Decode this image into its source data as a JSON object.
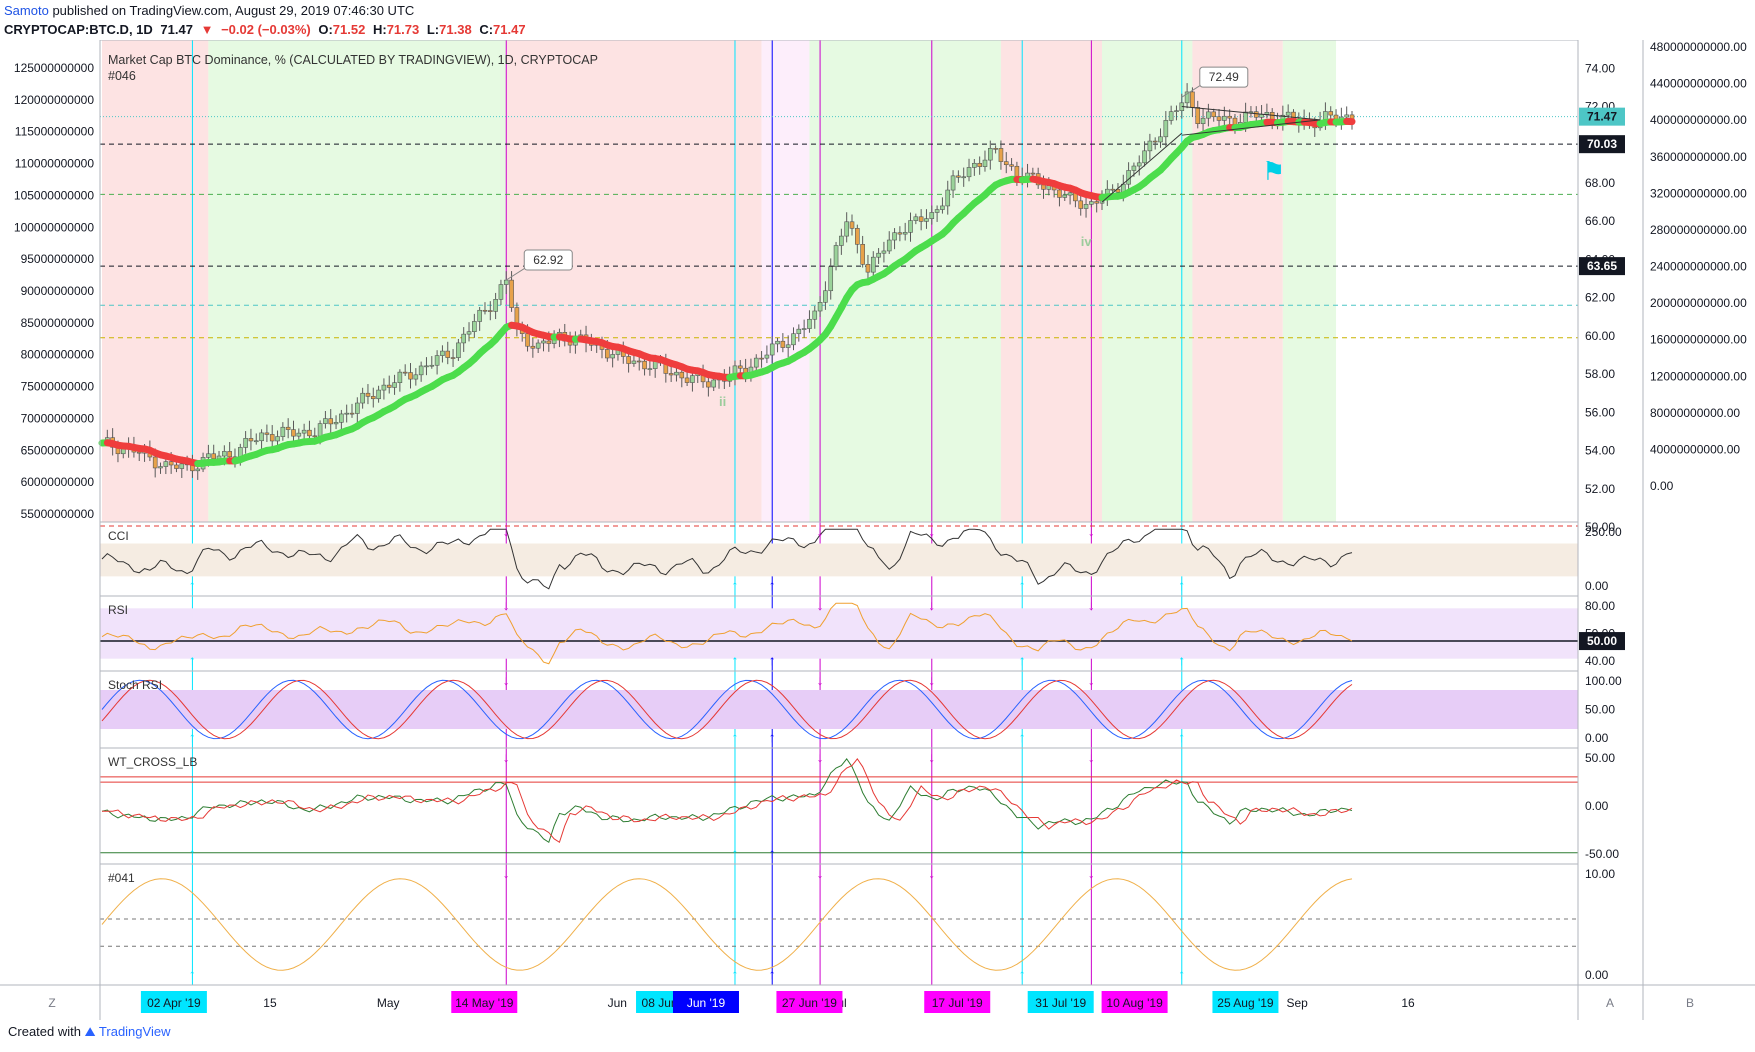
{
  "header": {
    "publisher": "Samoto",
    "published_text": "published on TradingView.com, August 29, 2019 07:46:30 UTC",
    "symbol": "CRYPTOCAP:BTC.D, 1D",
    "last": "71.47",
    "change": "−0.02 (−0.03%)",
    "o_label": "O:",
    "o_val": "71.52",
    "h_label": "H:",
    "h_val": "71.73",
    "l_label": "L:",
    "l_val": "71.38",
    "c_label": "C:",
    "c_val": "71.47"
  },
  "footer": {
    "created_with": "Created with",
    "brand": "TradingView"
  },
  "chart_data": {
    "type": "candlestick",
    "title": "Market Cap BTC Dominance, % (CALCULATED BY TRADINGVIEW), 1D, CRYPTOCAP",
    "subtitle": "#046",
    "dates_range": [
      "2019-03-23",
      "2019-08-29"
    ],
    "closes_anchor": [
      [
        0,
        54.4
      ],
      [
        6,
        54.0
      ],
      [
        12,
        53.2
      ],
      [
        16,
        53.1
      ],
      [
        20,
        53.6
      ],
      [
        24,
        53.8
      ],
      [
        30,
        54.8
      ],
      [
        40,
        55.0
      ],
      [
        46,
        56.0
      ],
      [
        52,
        57.2
      ],
      [
        60,
        58.3
      ],
      [
        66,
        59.2
      ],
      [
        70,
        60.7
      ],
      [
        74,
        62.0
      ],
      [
        76,
        62.9
      ],
      [
        78,
        60.2
      ],
      [
        82,
        59.4
      ],
      [
        86,
        60.0
      ],
      [
        92,
        59.6
      ],
      [
        98,
        58.8
      ],
      [
        104,
        58.4
      ],
      [
        110,
        57.8
      ],
      [
        114,
        57.6
      ],
      [
        118,
        57.9
      ],
      [
        122,
        58.5
      ],
      [
        126,
        59.3
      ],
      [
        130,
        60.0
      ],
      [
        134,
        61.0
      ],
      [
        138,
        64.5
      ],
      [
        140,
        66.0
      ],
      [
        144,
        63.5
      ],
      [
        150,
        65.6
      ],
      [
        156,
        66.3
      ],
      [
        160,
        68.0
      ],
      [
        164,
        69.0
      ],
      [
        168,
        69.6
      ],
      [
        172,
        68.5
      ],
      [
        178,
        67.8
      ],
      [
        182,
        67.1
      ],
      [
        186,
        66.9
      ],
      [
        190,
        67.5
      ],
      [
        196,
        69.5
      ],
      [
        200,
        71.2
      ],
      [
        204,
        72.5
      ],
      [
        206,
        71.5
      ],
      [
        212,
        71.3
      ],
      [
        218,
        71.6
      ],
      [
        224,
        71.3
      ],
      [
        228,
        71.2
      ],
      [
        232,
        71.5
      ],
      [
        235,
        71.47
      ]
    ],
    "price_axis": {
      "ticks": [
        "74.00",
        "72.00",
        "70.00",
        "68.00",
        "66.00",
        "64.00",
        "62.00",
        "60.00",
        "58.00",
        "56.00",
        "54.00",
        "52.00",
        "50.00"
      ],
      "min": 50,
      "max": 74.8
    },
    "left_axis": {
      "ticks": [
        "125000000000",
        "120000000000",
        "115000000000",
        "110000000000",
        "105000000000",
        "100000000000",
        "95000000000",
        "90000000000",
        "85000000000",
        "80000000000",
        "75000000000",
        "70000000000",
        "65000000000",
        "60000000000",
        "55000000000"
      ]
    },
    "right_axis": {
      "ticks": [
        "480000000000.00",
        "440000000000.00",
        "400000000000.00",
        "360000000000.00",
        "320000000000.00",
        "280000000000.00",
        "240000000000.00",
        "200000000000.00",
        "160000000000.00",
        "120000000000.00",
        "80000000000.00",
        "40000000000.00",
        "0.00"
      ]
    },
    "price_labels": [
      {
        "text": "71.47",
        "value": 71.47,
        "color": "#4dc6c6"
      },
      {
        "text": "70.03",
        "value": 70.03,
        "color": "#131722"
      },
      {
        "text": "63.65",
        "value": 63.65,
        "color": "#131722"
      }
    ],
    "callouts": [
      {
        "text": "62.92",
        "value": 62.92,
        "day": 76
      },
      {
        "text": "72.49",
        "value": 72.49,
        "day": 203
      }
    ],
    "wave_labels": [
      {
        "text": "ii",
        "day": 116
      },
      {
        "text": "iv",
        "day": 184
      }
    ],
    "time_axis": {
      "ticks": [
        {
          "label": "15",
          "day": 23
        },
        {
          "label": "May",
          "day": 39
        },
        {
          "label": "Jun",
          "day": 70
        },
        {
          "label": "Jul",
          "day": 100
        },
        {
          "label": "Sep",
          "day": 162
        },
        {
          "label": "16",
          "day": 177
        }
      ]
    },
    "date_markers": [
      {
        "label": "02 Apr '19",
        "day": 10,
        "color": "#00e5ff",
        "text_color": "#131722"
      },
      {
        "label": "14 May '19",
        "day": 52,
        "color": "#ff00ff",
        "text_color": "#131722"
      },
      {
        "label": "08 Jun '19",
        "day": 77,
        "color": "#00e5ff",
        "text_color": "#131722"
      },
      {
        "label": "Jun '19",
        "day": 82,
        "color": "#0000ff",
        "text_color": "#ffffff"
      },
      {
        "label": "27 Jun '19",
        "day": 96,
        "color": "#ff00ff",
        "text_color": "#131722"
      },
      {
        "label": "17 Jul '19",
        "day": 116,
        "color": "#ff00ff",
        "text_color": "#131722"
      },
      {
        "label": "31 Jul '19",
        "day": 130,
        "color": "#00e5ff",
        "text_color": "#131722"
      },
      {
        "label": "10 Aug '19",
        "day": 140,
        "color": "#ff00ff",
        "text_color": "#131722"
      },
      {
        "label": "25 Aug '19",
        "day": 155,
        "color": "#00e5ff",
        "text_color": "#131722"
      }
    ],
    "panels": [
      {
        "name": "CCI",
        "ticks": [
          "250.00",
          "0.00"
        ]
      },
      {
        "name": "RSI",
        "ticks": [
          "80.00",
          "50.00",
          "40.00"
        ],
        "badge": "50.00"
      },
      {
        "name": "Stoch RSI",
        "ticks": [
          "100.00",
          "50.00",
          "0.00"
        ]
      },
      {
        "name": "WT_CROSS_LB",
        "ticks": [
          "50.00",
          "0.00",
          "-50.00"
        ]
      },
      {
        "name": "#041",
        "ticks": [
          "10.00",
          "0.00"
        ]
      }
    ],
    "corner_labels": {
      "z": "Z",
      "a": "A",
      "b": "B"
    }
  }
}
